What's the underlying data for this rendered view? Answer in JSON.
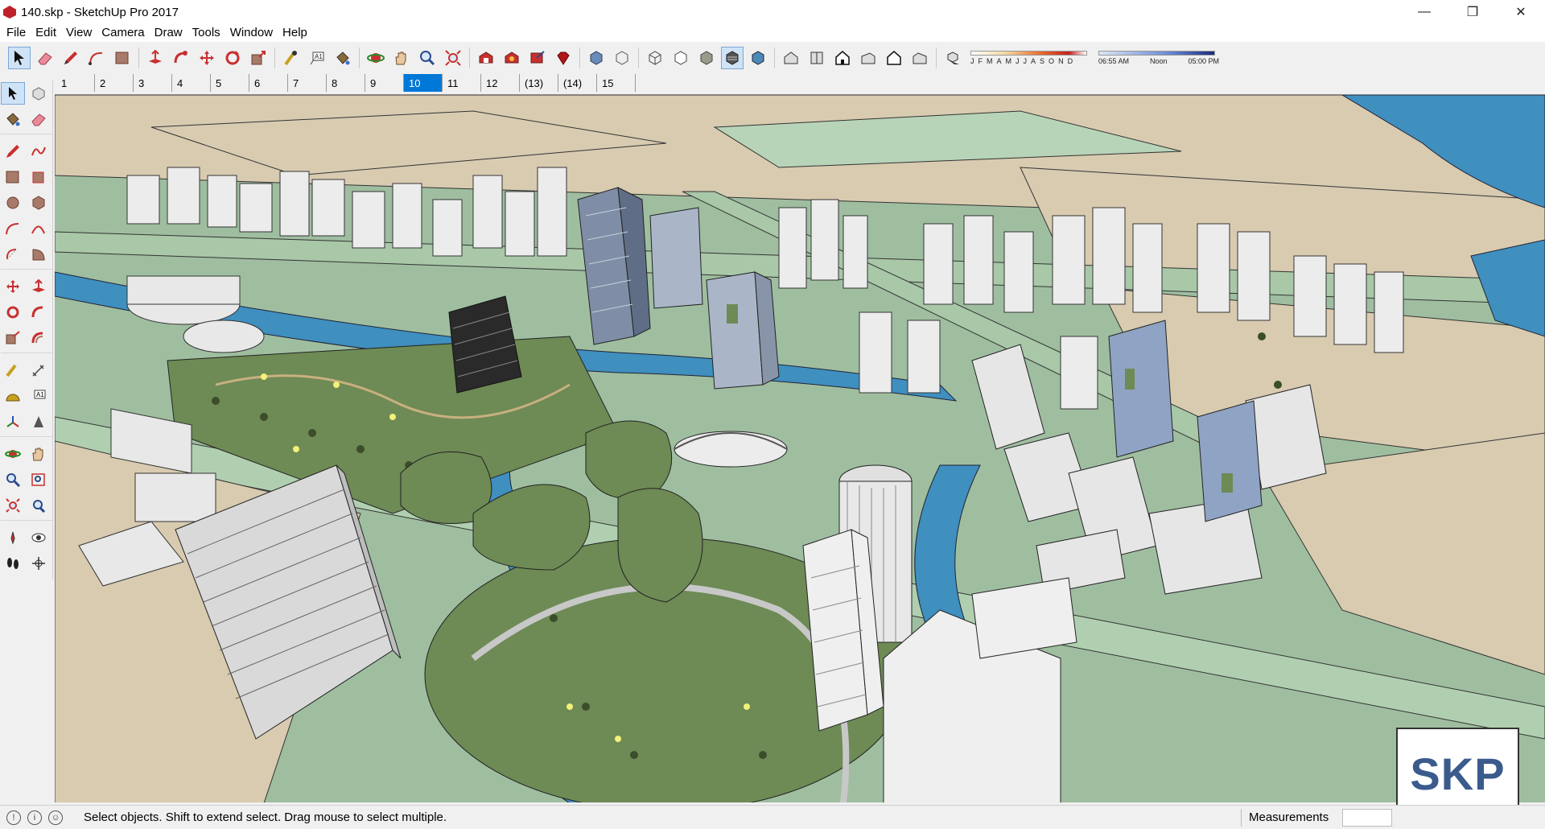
{
  "window": {
    "title": "140.skp - SketchUp Pro 2017",
    "controls": {
      "minimize": "—",
      "maximize": "❐",
      "close": "✕"
    }
  },
  "menubar": {
    "items": [
      "File",
      "Edit",
      "View",
      "Camera",
      "Draw",
      "Tools",
      "Window",
      "Help"
    ]
  },
  "toolbar": {
    "shadow_months": [
      "J",
      "F",
      "M",
      "A",
      "M",
      "J",
      "J",
      "A",
      "S",
      "O",
      "N",
      "D"
    ],
    "shadow_times": [
      "06:55 AM",
      "Noon",
      "05:00 PM"
    ],
    "accent_color": "#0078d7"
  },
  "scenes": {
    "tabs": [
      "1",
      "2",
      "3",
      "4",
      "5",
      "6",
      "7",
      "8",
      "9",
      "10",
      "11",
      "12",
      "(13)",
      "(14)",
      "15"
    ],
    "active_index": 9
  },
  "statusbar": {
    "message": "Select objects. Shift to extend select. Drag mouse to select multiple.",
    "measurements_label": "Measurements",
    "measurements_value": ""
  },
  "watermark": {
    "text": "SKP"
  }
}
